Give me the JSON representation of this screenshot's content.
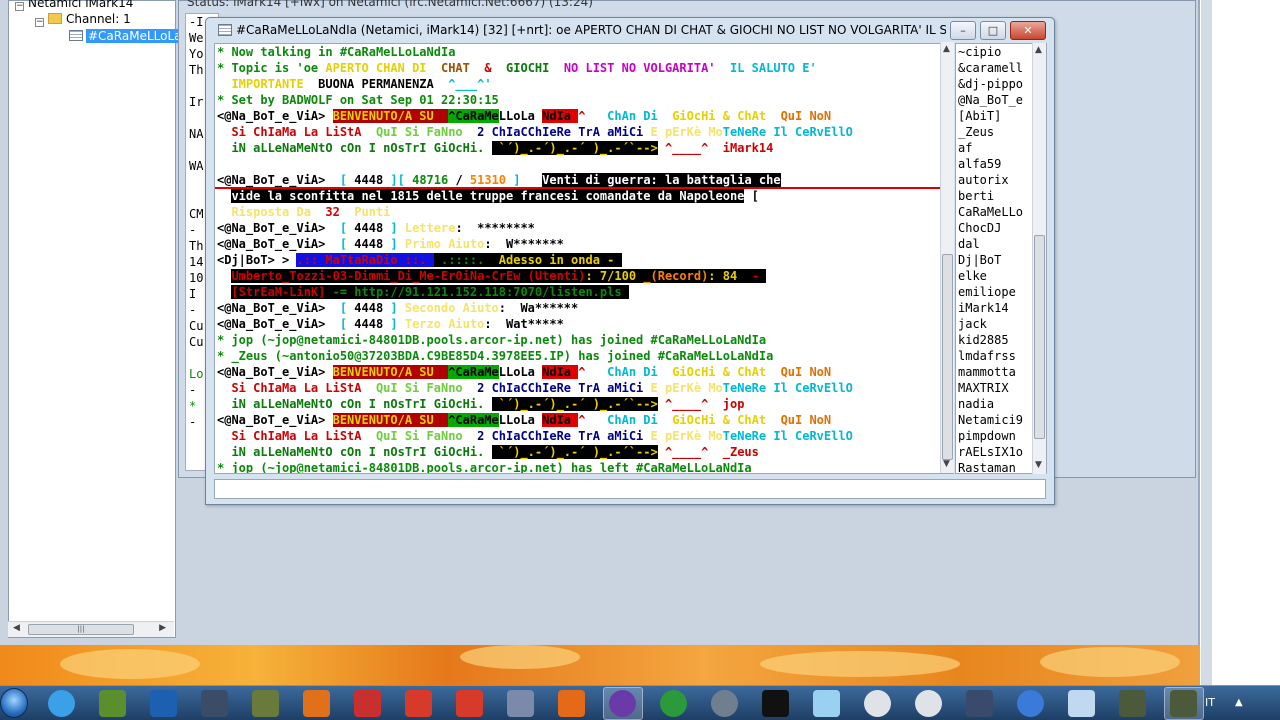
{
  "tree": {
    "server": "Netamici iMark14",
    "channel_group": "Channel: 1",
    "selected_channel": "#CaRaMeLLoLa"
  },
  "status_window": {
    "title": "Status: iMark14 [+iwx] on Netamici (irc.Netamici.Net:6667) (13:24)",
    "lines": [
      "-I",
      "We",
      "Yo",
      "Th",
      "",
      "Ir",
      "",
      "NA",
      "",
      "WA",
      "",
      "",
      "CM",
      "-",
      "Th",
      "14",
      "10",
      "I",
      "-",
      "Cu",
      "Cu",
      "",
      "Lo",
      "-",
      "*",
      "-"
    ]
  },
  "channel_window": {
    "title": "#CaRaMeLLoLaNdIa (Netamici, iMark14) [32] [+nrt]: oe APERTO CHAN DI  CHAT  &  GIOCHI  NO LIST NO VOLGARITA'  IL SALUTO E'...",
    "minimize": "–",
    "maximize": "□",
    "close": "✕"
  },
  "messages": [
    {
      "parts": [
        {
          "t": "* Now talking in #CaRaMeLLoLaNdIa",
          "c": "c-grn"
        }
      ]
    },
    {
      "parts": [
        {
          "t": "* Topic is 'oe ",
          "c": "c-grn"
        },
        {
          "t": "APERTO CHAN DI  ",
          "c": "c-yel"
        },
        {
          "t": "CHAT  ",
          "c": "c-brn"
        },
        {
          "t": "&  ",
          "c": "c-red"
        },
        {
          "t": "GIOCHI  ",
          "c": "c-dgrn"
        },
        {
          "t": "NO LIST NO VOLGARITA'  ",
          "c": "c-mag"
        },
        {
          "t": "IL SALUTO E'",
          "c": "c-cyn"
        }
      ]
    },
    {
      "parts": [
        {
          "t": "  ",
          "c": ""
        },
        {
          "t": "IMPORTANTE  ",
          "c": "c-yel"
        },
        {
          "t": "BUONA PERMANENZA  ",
          "c": "c-dred"
        },
        {
          "t": "^___^'",
          "c": "c-cyn"
        }
      ]
    },
    {
      "parts": [
        {
          "t": "* Set by BADWOLF on Sat Sep 01 22:30:15",
          "c": "c-grn"
        }
      ]
    },
    {
      "parts": [
        {
          "t": "<@Na_BoT_e_ViA> ",
          "c": "c-blk"
        },
        {
          "t": "BENVENUTO/A SU  ",
          "c": "c-yel bg-dred"
        },
        {
          "t": "^CaRaMe",
          "c": "c-blk bg-grn"
        },
        {
          "t": "LLoLa ",
          "c": ""
        },
        {
          "t": "NdIa ",
          "c": "c-blk bg-red"
        },
        {
          "t": "^   ",
          "c": "c-red"
        },
        {
          "t": "ChAn Di  ",
          "c": "c-cyn"
        },
        {
          "t": "GiOcHi & ChAt  ",
          "c": "c-yel"
        },
        {
          "t": "QuI NoN",
          "c": "c-org2"
        }
      ]
    },
    {
      "parts": [
        {
          "t": "  Si ChIaMa La LiStA  ",
          "c": "c-red"
        },
        {
          "t": "QuI Si FaNno  ",
          "c": "c-lgrn"
        },
        {
          "t": "2 ",
          "c": "c-navy"
        },
        {
          "t": "ChIaCChIeRe TrA aMiCi ",
          "c": "c-blu"
        },
        {
          "t": "E pErKè Mo",
          "c": "c-lyel"
        },
        {
          "t": "TeNeRe Il CeRvEllO",
          "c": "c-cyn"
        }
      ]
    },
    {
      "parts": [
        {
          "t": "  iN aLLeNaMeNtO cOn I nOsTrI GiOcHi. ",
          "c": "c-dgrn"
        },
        {
          "t": " `´)_.-´)_.-´ )_.-´`-->",
          "c": "c-yel bg-blk"
        },
        {
          "t": " ^____^  ",
          "c": "c-red"
        },
        {
          "t": "iMark14",
          "c": "c-red"
        }
      ]
    },
    {
      "parts": [
        {
          "t": "",
          "c": ""
        }
      ]
    },
    {
      "parts": [
        {
          "t": "<@Na_BoT_e_ViA> ",
          "c": ""
        },
        {
          "t": " [ ",
          "c": "c-cyn"
        },
        {
          "t": "4448 ",
          "c": ""
        },
        {
          "t": "][ ",
          "c": "c-cyn"
        },
        {
          "t": "48716 ",
          "c": "c-grn"
        },
        {
          "t": "/ ",
          "c": ""
        },
        {
          "t": "51310 ",
          "c": "c-orn"
        },
        {
          "t": "]   ",
          "c": "c-cyn"
        },
        {
          "t": "Venti di guerra: la battaglia che",
          "c": "c-wht bg-blk"
        }
      ]
    },
    {
      "parts": [
        {
          "t": "  ",
          "c": ""
        },
        {
          "t": "vide la sconfitta nel 1815 delle truppe francesi comandate da Napoleone",
          "c": "c-wht bg-blk"
        },
        {
          "t": " [",
          "c": ""
        }
      ]
    },
    {
      "parts": [
        {
          "t": "  Risposta Da  ",
          "c": "c-lyel"
        },
        {
          "t": "32  ",
          "c": "c-red"
        },
        {
          "t": "Punti",
          "c": "c-lyel"
        }
      ]
    },
    {
      "parts": [
        {
          "t": "<@Na_BoT_e_ViA> ",
          "c": ""
        },
        {
          "t": " [ ",
          "c": "c-cyn"
        },
        {
          "t": "4448 ",
          "c": ""
        },
        {
          "t": "] ",
          "c": "c-cyn"
        },
        {
          "t": "Lettere",
          "c": "c-lyel"
        },
        {
          "t": ":  ********",
          "c": ""
        }
      ]
    },
    {
      "parts": [
        {
          "t": "<@Na_BoT_e_ViA> ",
          "c": ""
        },
        {
          "t": " [ ",
          "c": "c-cyn"
        },
        {
          "t": "4448 ",
          "c": ""
        },
        {
          "t": "] ",
          "c": "c-cyn"
        },
        {
          "t": "Primo Aiuto",
          "c": "c-lyel"
        },
        {
          "t": ":  W*******",
          "c": ""
        }
      ]
    },
    {
      "parts": [
        {
          "t": "<Dj|BoT> > ",
          "c": ""
        },
        {
          "t": ".:: MaTtaRaDio ::. ",
          "c": "c-red bg-blu"
        },
        {
          "t": " .::::. ",
          "c": "c-grn bg-blk"
        },
        {
          "t": " Adesso in onda - ",
          "c": "c-yel bg-blk"
        }
      ]
    },
    {
      "parts": [
        {
          "t": "  ",
          "c": ""
        },
        {
          "t": "Umberto_Tozzi-03-Dimmi_Di_Me-Er0iNa-CrEw ",
          "c": "c-red bg-blk"
        },
        {
          "t": "(Utenti)",
          "c": "c-red bg-blk"
        },
        {
          "t": ": 7/100 ",
          "c": "c-yel bg-blk"
        },
        {
          "t": "_(Record)",
          "c": "c-orn bg-blk"
        },
        {
          "t": ": 84 ",
          "c": "c-yel bg-blk"
        },
        {
          "t": " - ",
          "c": "c-red bg-blk"
        }
      ]
    },
    {
      "parts": [
        {
          "t": "  ",
          "c": ""
        },
        {
          "t": "[StrEaM-LinK]",
          "c": "c-red bg-blk"
        },
        {
          "t": " -= http://91.121.152.118:7070/listen.pls ",
          "c": "c-grn bg-blk"
        }
      ]
    },
    {
      "parts": [
        {
          "t": "<@Na_BoT_e_ViA> ",
          "c": ""
        },
        {
          "t": " [ ",
          "c": "c-cyn"
        },
        {
          "t": "4448 ",
          "c": ""
        },
        {
          "t": "] ",
          "c": "c-cyn"
        },
        {
          "t": "Secondo Aiuto",
          "c": "c-lyel"
        },
        {
          "t": ":  Wa******",
          "c": ""
        }
      ]
    },
    {
      "parts": [
        {
          "t": "<@Na_BoT_e_ViA> ",
          "c": ""
        },
        {
          "t": " [ ",
          "c": "c-cyn"
        },
        {
          "t": "4448 ",
          "c": ""
        },
        {
          "t": "] ",
          "c": "c-cyn"
        },
        {
          "t": "Terzo Aiuto",
          "c": "c-lyel"
        },
        {
          "t": ":  Wat*****",
          "c": ""
        }
      ]
    },
    {
      "parts": [
        {
          "t": "* jop (~jop@netamici-84801DB.pools.arcor-ip.net) has joined #CaRaMeLLoLaNdIa",
          "c": "c-grn"
        }
      ]
    },
    {
      "parts": [
        {
          "t": "* _Zeus (~antonio50@37203BDA.C9BE85D4.3978EE5.IP) has joined #CaRaMeLLoLaNdIa",
          "c": "c-grn"
        }
      ]
    },
    {
      "parts": [
        {
          "t": "<@Na_BoT_e_ViA> ",
          "c": ""
        },
        {
          "t": "BENVENUTO/A SU  ",
          "c": "c-yel bg-dred"
        },
        {
          "t": "^CaRaMe",
          "c": "c-blk bg-grn"
        },
        {
          "t": "LLoLa ",
          "c": ""
        },
        {
          "t": "NdIa ",
          "c": "c-blk bg-red"
        },
        {
          "t": "^   ",
          "c": "c-red"
        },
        {
          "t": "ChAn Di  ",
          "c": "c-cyn"
        },
        {
          "t": "GiOcHi & ChAt  ",
          "c": "c-yel"
        },
        {
          "t": "QuI NoN",
          "c": "c-org2"
        }
      ]
    },
    {
      "parts": [
        {
          "t": "  Si ChIaMa La LiStA  ",
          "c": "c-red"
        },
        {
          "t": "QuI Si FaNno  ",
          "c": "c-lgrn"
        },
        {
          "t": "2 ",
          "c": "c-navy"
        },
        {
          "t": "ChIaCChIeRe TrA aMiCi ",
          "c": "c-blu"
        },
        {
          "t": "E pErKè Mo",
          "c": "c-lyel"
        },
        {
          "t": "TeNeRe Il CeRvEllO",
          "c": "c-cyn"
        }
      ]
    },
    {
      "parts": [
        {
          "t": "  iN aLLeNaMeNtO cOn I nOsTrI GiOcHi. ",
          "c": "c-dgrn"
        },
        {
          "t": " `´)_.-´)_.-´ )_.-´`-->",
          "c": "c-yel bg-blk"
        },
        {
          "t": " ^____^  ",
          "c": "c-red"
        },
        {
          "t": "jop",
          "c": "c-red"
        }
      ]
    },
    {
      "parts": [
        {
          "t": "<@Na_BoT_e_ViA> ",
          "c": ""
        },
        {
          "t": "BENVENUTO/A SU  ",
          "c": "c-yel bg-dred"
        },
        {
          "t": "^CaRaMe",
          "c": "c-blk bg-grn"
        },
        {
          "t": "LLoLa ",
          "c": ""
        },
        {
          "t": "NdIa ",
          "c": "c-blk bg-red"
        },
        {
          "t": "^   ",
          "c": "c-red"
        },
        {
          "t": "ChAn Di  ",
          "c": "c-cyn"
        },
        {
          "t": "GiOcHi & ChAt  ",
          "c": "c-yel"
        },
        {
          "t": "QuI NoN",
          "c": "c-org2"
        }
      ]
    },
    {
      "parts": [
        {
          "t": "  Si ChIaMa La LiStA  ",
          "c": "c-red"
        },
        {
          "t": "QuI Si FaNno  ",
          "c": "c-lgrn"
        },
        {
          "t": "2 ",
          "c": "c-navy"
        },
        {
          "t": "ChIaCChIeRe TrA aMiCi ",
          "c": "c-blu"
        },
        {
          "t": "E pErKè Mo",
          "c": "c-lyel"
        },
        {
          "t": "TeNeRe Il CeRvEllO",
          "c": "c-cyn"
        }
      ]
    },
    {
      "parts": [
        {
          "t": "  iN aLLeNaMeNtO cOn I nOsTrI GiOcHi. ",
          "c": "c-dgrn"
        },
        {
          "t": " `´)_.-´)_.-´ )_.-´`-->",
          "c": "c-yel bg-blk"
        },
        {
          "t": " ^____^  ",
          "c": "c-red"
        },
        {
          "t": "_Zeus",
          "c": "c-red"
        }
      ]
    },
    {
      "parts": [
        {
          "t": "* jop (~jop@netamici-84801DB.pools.arcor-ip.net) has left #CaRaMeLLoLaNdIa",
          "c": "c-grn"
        }
      ]
    }
  ],
  "nicklist": [
    "~cipio",
    "&caramell",
    "&dj-pippo",
    "@Na_BoT_e",
    "[AbiT]",
    "_Zeus",
    "af",
    "alfa59",
    "autorix",
    "berti",
    "CaRaMeLLo",
    "ChocDJ",
    "dal",
    "Dj|BoT",
    "elke",
    "emiliope",
    "iMark14",
    "jack",
    "kid2885",
    "lmdafrss",
    "mammotta",
    "MAXTRIX",
    "nadia",
    "Netamici9",
    "pimpdown",
    "rAELsIX1o",
    "Rastaman"
  ],
  "taskbar": {
    "language": "IT",
    "icons": [
      "clock-app-icon",
      "minecraft-icon",
      "vb-icon",
      "settings-gear-icon",
      "game-icon",
      "paw-icon",
      "phone-app-icon",
      "download-icon",
      "upload-icon",
      "box-icon",
      "mirc-icon",
      "browser-icon",
      "utorrent-icon",
      "orb-icon",
      "terminal-icon",
      "tool-icon",
      "disc-icon",
      "disc2-icon",
      "network-icon",
      "itunes-icon",
      "recycle-icon",
      "game2-icon",
      "game3-icon"
    ],
    "icon_colors": [
      "#3aa0e8",
      "#5b8f2e",
      "#1d5fb0",
      "#3b4d66",
      "#6a7a3a",
      "#e0701a",
      "#c83030",
      "#d83a2a",
      "#d83a2a",
      "#7a8aa8",
      "#e46a1a",
      "#6a3aa8",
      "#2a9a3a",
      "#6f7f90",
      "#111111",
      "#9ad0f0",
      "#dfe3e8",
      "#dfe3e8",
      "#3a4a6a",
      "#3a7ad8",
      "#c0d8f0",
      "#4a5a3a",
      "#4a5a3a"
    ]
  }
}
